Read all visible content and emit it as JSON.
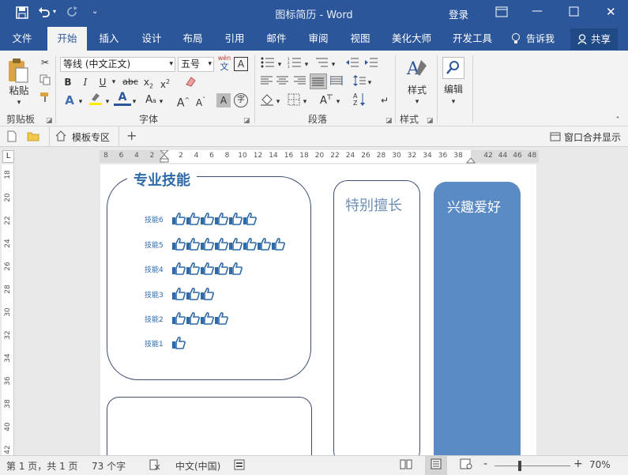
{
  "window": {
    "title": "图标简历 - Word",
    "login": "登录"
  },
  "tabs": [
    "文件",
    "开始",
    "插入",
    "设计",
    "布局",
    "引用",
    "邮件",
    "审阅",
    "视图",
    "美化大师",
    "开发工具"
  ],
  "active_tab": "开始",
  "tell_me": "告诉我",
  "share": "共享",
  "ribbon": {
    "clipboard": {
      "paste": "粘贴",
      "label": "剪贴板"
    },
    "font": {
      "name": "等线 (中文正文)",
      "size": "五号",
      "label": "字体",
      "pinyin_top": "wén",
      "pinyin_bottom": "文"
    },
    "paragraph": {
      "label": "段落"
    },
    "styles": {
      "button": "样式",
      "label": "样式"
    },
    "editing": {
      "button": "编辑"
    }
  },
  "docbar": {
    "template_zone": "模板专区",
    "window_merge": "窗口合并显示"
  },
  "ruler": {
    "h_ticks_left": [
      "8",
      "6",
      "4",
      "2"
    ],
    "h_ticks_main": [
      "2",
      "4",
      "6",
      "8",
      "10",
      "12",
      "14",
      "16",
      "18",
      "20",
      "22",
      "24",
      "26",
      "28",
      "30",
      "32",
      "34",
      "36",
      "38"
    ],
    "h_ticks_right": [
      "42",
      "44",
      "46",
      "48"
    ],
    "v_ticks": [
      "18",
      "20",
      "22",
      "24",
      "26",
      "28",
      "30",
      "32",
      "34",
      "36",
      "38",
      "40",
      "42"
    ],
    "corner": "L"
  },
  "document": {
    "skills_title": "专业技能",
    "special_title": "特别擅长",
    "hobby_title": "兴趣爱好",
    "skills": [
      {
        "label": "技能6",
        "count": 6
      },
      {
        "label": "技能5",
        "count": 8
      },
      {
        "label": "技能4",
        "count": 5
      },
      {
        "label": "技能3",
        "count": 3
      },
      {
        "label": "技能2",
        "count": 4
      },
      {
        "label": "技能1",
        "count": 1
      }
    ],
    "colors": {
      "accent": "#2b579a",
      "hobby_fill": "#5b8bc4",
      "skill_blue": "#2f6aa8"
    }
  },
  "status": {
    "page": "第 1 页，共 1 页",
    "words": "73 个字",
    "language": "中文(中国)",
    "zoom": "70%",
    "zoom_minus": "-",
    "zoom_plus": "+"
  }
}
